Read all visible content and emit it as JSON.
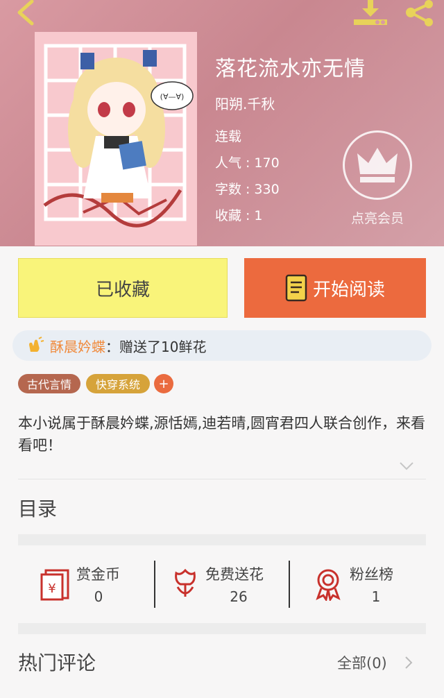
{
  "book": {
    "title": "落花流水亦无情",
    "author": "阳朔.千秋",
    "status": "连载",
    "popularity_label": "人气",
    "popularity_value": "170",
    "words_label": "字数",
    "words_value": "330",
    "favorites_label": "收藏",
    "favorites_value": "1",
    "cover_text": "(∀—∀)"
  },
  "vip": {
    "label": "点亮会员"
  },
  "actions": {
    "favorite_label": "已收藏",
    "read_label": "开始阅读"
  },
  "notice": {
    "user": "酥晨妗蝶",
    "message": "：赠送了10鲜花"
  },
  "tags": [
    {
      "label": "古代言情"
    },
    {
      "label": "快穿系统"
    },
    {
      "label": "+"
    }
  ],
  "summary": "本小说属于酥晨妗蝶,源恬嫣,迪若晴,圆宵君四人联合创作，来看看吧！",
  "toc": {
    "title": "目录"
  },
  "stats": [
    {
      "label": "赏金币",
      "value": "0",
      "icon": "red-envelope-icon"
    },
    {
      "label": "免费送花",
      "value": "26",
      "icon": "flower-icon"
    },
    {
      "label": "粉丝榜",
      "value": "1",
      "icon": "medal-icon"
    }
  ],
  "comments": {
    "title": "热门评论",
    "all_label": "全部(0)"
  },
  "colors": {
    "accent_orange": "#ec6a3e",
    "fav_yellow": "#f9f47a",
    "header_pink": "#d99aa2"
  }
}
